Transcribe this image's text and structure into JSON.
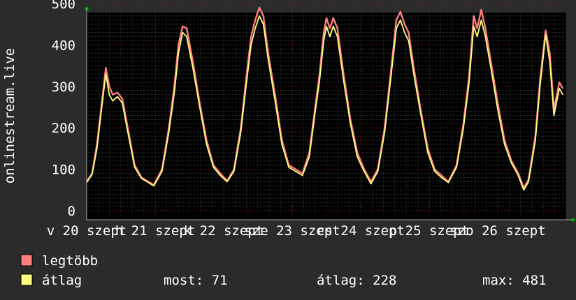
{
  "chart_data": {
    "type": "line",
    "ylabel": "onlinestream.live",
    "ylim": [
      0,
      500
    ],
    "yticks": [
      0,
      100,
      200,
      300,
      400,
      500
    ],
    "xlim": [
      0,
      7
    ],
    "x_ticks": [
      {
        "x": 0,
        "label": "v 20 szept"
      },
      {
        "x": 1,
        "label": "h 21 szept"
      },
      {
        "x": 2,
        "label": "k 22 szept"
      },
      {
        "x": 3,
        "label": "sze 23 szept"
      },
      {
        "x": 4,
        "label": "cs 24 szept"
      },
      {
        "x": 5,
        "label": "p 25 szept"
      },
      {
        "x": 6,
        "label": "szo 26 szept"
      }
    ],
    "grid": true,
    "series": [
      {
        "name": "legtöbb",
        "color": "#ff7f7f",
        "points": [
          [
            0.0,
            70
          ],
          [
            0.08,
            90
          ],
          [
            0.15,
            160
          ],
          [
            0.22,
            260
          ],
          [
            0.28,
            345
          ],
          [
            0.33,
            300
          ],
          [
            0.38,
            280
          ],
          [
            0.45,
            285
          ],
          [
            0.52,
            270
          ],
          [
            0.6,
            200
          ],
          [
            0.7,
            110
          ],
          [
            0.8,
            80
          ],
          [
            0.9,
            70
          ],
          [
            0.98,
            62
          ],
          [
            1.1,
            100
          ],
          [
            1.2,
            200
          ],
          [
            1.28,
            300
          ],
          [
            1.34,
            400
          ],
          [
            1.4,
            445
          ],
          [
            1.46,
            440
          ],
          [
            1.55,
            360
          ],
          [
            1.65,
            260
          ],
          [
            1.75,
            170
          ],
          [
            1.85,
            110
          ],
          [
            1.95,
            90
          ],
          [
            2.05,
            72
          ],
          [
            2.15,
            100
          ],
          [
            2.25,
            200
          ],
          [
            2.33,
            320
          ],
          [
            2.4,
            420
          ],
          [
            2.46,
            460
          ],
          [
            2.52,
            490
          ],
          [
            2.58,
            470
          ],
          [
            2.65,
            380
          ],
          [
            2.75,
            280
          ],
          [
            2.85,
            170
          ],
          [
            2.95,
            110
          ],
          [
            3.05,
            100
          ],
          [
            3.15,
            90
          ],
          [
            3.25,
            140
          ],
          [
            3.32,
            230
          ],
          [
            3.4,
            330
          ],
          [
            3.46,
            430
          ],
          [
            3.5,
            465
          ],
          [
            3.55,
            440
          ],
          [
            3.6,
            465
          ],
          [
            3.66,
            440
          ],
          [
            3.75,
            330
          ],
          [
            3.85,
            220
          ],
          [
            3.95,
            140
          ],
          [
            4.05,
            100
          ],
          [
            4.15,
            70
          ],
          [
            4.25,
            100
          ],
          [
            4.35,
            200
          ],
          [
            4.45,
            350
          ],
          [
            4.52,
            460
          ],
          [
            4.58,
            480
          ],
          [
            4.64,
            450
          ],
          [
            4.7,
            430
          ],
          [
            4.78,
            340
          ],
          [
            4.88,
            240
          ],
          [
            4.98,
            150
          ],
          [
            5.08,
            100
          ],
          [
            5.18,
            85
          ],
          [
            5.28,
            70
          ],
          [
            5.4,
            110
          ],
          [
            5.5,
            210
          ],
          [
            5.58,
            320
          ],
          [
            5.65,
            470
          ],
          [
            5.7,
            440
          ],
          [
            5.76,
            485
          ],
          [
            5.82,
            440
          ],
          [
            5.9,
            360
          ],
          [
            6.0,
            260
          ],
          [
            6.1,
            170
          ],
          [
            6.2,
            120
          ],
          [
            6.3,
            90
          ],
          [
            6.38,
            55
          ],
          [
            6.45,
            75
          ],
          [
            6.55,
            180
          ],
          [
            6.62,
            320
          ],
          [
            6.7,
            435
          ],
          [
            6.76,
            380
          ],
          [
            6.82,
            245
          ],
          [
            6.9,
            310
          ],
          [
            6.95,
            295
          ],
          [
            7.05,
            190
          ],
          [
            7.15,
            130
          ],
          [
            7.25,
            90
          ],
          [
            7.35,
            70
          ]
        ]
      },
      {
        "name": "átlag",
        "color": "#ffff80",
        "points": [
          [
            0.0,
            68
          ],
          [
            0.08,
            88
          ],
          [
            0.15,
            150
          ],
          [
            0.22,
            250
          ],
          [
            0.28,
            330
          ],
          [
            0.33,
            280
          ],
          [
            0.38,
            265
          ],
          [
            0.45,
            275
          ],
          [
            0.52,
            260
          ],
          [
            0.6,
            190
          ],
          [
            0.7,
            105
          ],
          [
            0.8,
            78
          ],
          [
            0.9,
            68
          ],
          [
            0.98,
            60
          ],
          [
            1.1,
            95
          ],
          [
            1.2,
            190
          ],
          [
            1.28,
            285
          ],
          [
            1.34,
            380
          ],
          [
            1.4,
            430
          ],
          [
            1.46,
            420
          ],
          [
            1.55,
            345
          ],
          [
            1.65,
            250
          ],
          [
            1.75,
            160
          ],
          [
            1.85,
            105
          ],
          [
            1.95,
            85
          ],
          [
            2.05,
            70
          ],
          [
            2.15,
            95
          ],
          [
            2.25,
            190
          ],
          [
            2.33,
            305
          ],
          [
            2.4,
            400
          ],
          [
            2.46,
            440
          ],
          [
            2.52,
            470
          ],
          [
            2.58,
            450
          ],
          [
            2.65,
            365
          ],
          [
            2.75,
            265
          ],
          [
            2.85,
            160
          ],
          [
            2.95,
            105
          ],
          [
            3.05,
            95
          ],
          [
            3.15,
            85
          ],
          [
            3.25,
            130
          ],
          [
            3.32,
            220
          ],
          [
            3.4,
            315
          ],
          [
            3.46,
            410
          ],
          [
            3.5,
            445
          ],
          [
            3.55,
            420
          ],
          [
            3.6,
            445
          ],
          [
            3.66,
            420
          ],
          [
            3.75,
            315
          ],
          [
            3.85,
            210
          ],
          [
            3.95,
            130
          ],
          [
            4.05,
            95
          ],
          [
            4.15,
            65
          ],
          [
            4.25,
            95
          ],
          [
            4.35,
            190
          ],
          [
            4.45,
            335
          ],
          [
            4.52,
            440
          ],
          [
            4.58,
            460
          ],
          [
            4.64,
            430
          ],
          [
            4.7,
            410
          ],
          [
            4.78,
            325
          ],
          [
            4.88,
            230
          ],
          [
            4.98,
            140
          ],
          [
            5.08,
            95
          ],
          [
            5.18,
            80
          ],
          [
            5.28,
            68
          ],
          [
            5.4,
            105
          ],
          [
            5.5,
            200
          ],
          [
            5.58,
            305
          ],
          [
            5.65,
            445
          ],
          [
            5.7,
            420
          ],
          [
            5.76,
            460
          ],
          [
            5.82,
            420
          ],
          [
            5.9,
            345
          ],
          [
            6.0,
            245
          ],
          [
            6.1,
            160
          ],
          [
            6.2,
            115
          ],
          [
            6.3,
            85
          ],
          [
            6.38,
            50
          ],
          [
            6.45,
            70
          ],
          [
            6.55,
            170
          ],
          [
            6.62,
            305
          ],
          [
            6.7,
            425
          ],
          [
            6.76,
            360
          ],
          [
            6.82,
            230
          ],
          [
            6.9,
            295
          ],
          [
            6.95,
            280
          ],
          [
            7.05,
            180
          ],
          [
            7.15,
            120
          ],
          [
            7.25,
            85
          ],
          [
            7.35,
            68
          ]
        ]
      }
    ]
  },
  "legend": {
    "items": [
      {
        "label": "legtöbb",
        "color": "#ff7f7f"
      },
      {
        "label": "átlag",
        "color": "#ffff80"
      }
    ],
    "stats": {
      "most": "most: 71",
      "atlag": "átlag: 228",
      "max": "max: 481"
    }
  }
}
